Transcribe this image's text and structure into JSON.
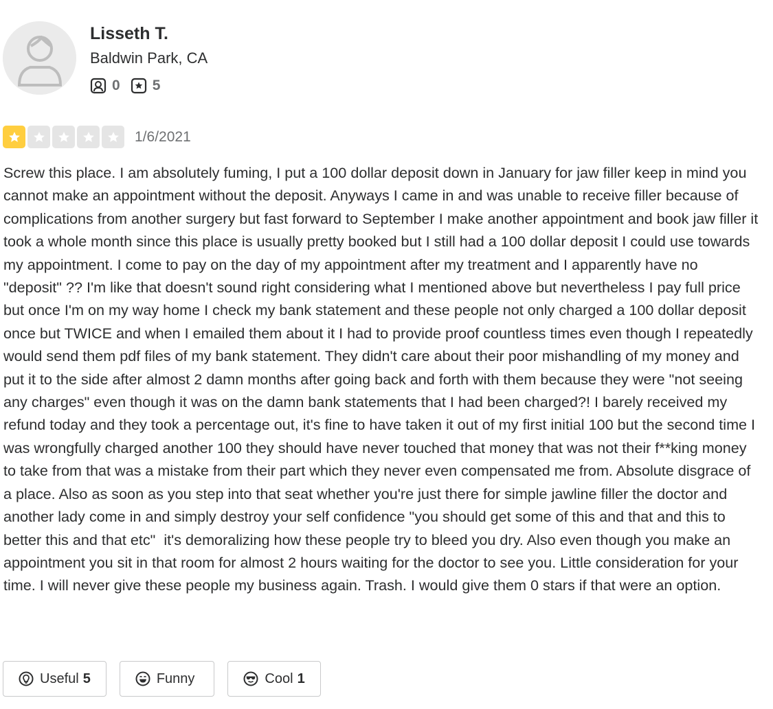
{
  "user": {
    "name": "Lisseth T.",
    "location": "Baldwin Park, CA",
    "friends_count": "0",
    "reviews_count": "5",
    "avatar_icon": "default-avatar-icon",
    "friends_icon": "friends-icon",
    "reviews_icon": "review-star-icon"
  },
  "review": {
    "rating": 1,
    "rating_max": 5,
    "star_color": "#ffce3f",
    "empty_star_color": "#e5e5e5",
    "date": "1/6/2021",
    "text": "Screw this place. I am absolutely fuming, I put a 100 dollar deposit down in January for jaw filler keep in mind you cannot make an appointment without the deposit. Anyways I came in and was unable to receive filler because of complications from another surgery but fast forward to September I make another appointment and book jaw filler it took a whole month since this place is usually pretty booked but I still had a 100 dollar deposit I could use towards my appointment. I come to pay on the day of my appointment after my treatment and I apparently have no \"deposit\" ?? I'm like that doesn't sound right considering what I mentioned above but nevertheless I pay full price but once I'm on my way home I check my bank statement and these people not only charged a 100 dollar deposit once but TWICE and when I emailed them about it I had to provide proof countless times even though I repeatedly would send them pdf files of my bank statement. They didn't care about their poor mishandling of my money and put it to the side after almost 2 damn months after going back and forth with them because they were \"not seeing any charges\" even though it was on the damn bank statements that I had been charged?! I barely received my refund today and they took a percentage out, it's fine to have taken it out of my first initial 100 but the second time I was wrongfully charged another 100 they should have never touched that money that was not their f**king money to take from that was a mistake from their part which they never even compensated me from. Absolute disgrace of a place. Also as soon as you step into that seat whether you're just there for simple jawline filler the doctor and another lady come in and simply destroy your self confidence \"you should get some of this and that and this to better this and that etc\"  it's demoralizing how these people try to bleed you dry. Also even though you make an appointment you sit in that room for almost 2 hours waiting for the doctor to see you. Little consideration for your time. I will never give these people my business again. Trash. I would give them 0 stars if that were an option."
  },
  "reactions": {
    "useful": {
      "label": "Useful",
      "count": "5",
      "icon": "lightbulb-icon"
    },
    "funny": {
      "label": "Funny",
      "count": "",
      "icon": "smiley-icon"
    },
    "cool": {
      "label": "Cool",
      "count": "1",
      "icon": "sunglasses-icon"
    }
  }
}
